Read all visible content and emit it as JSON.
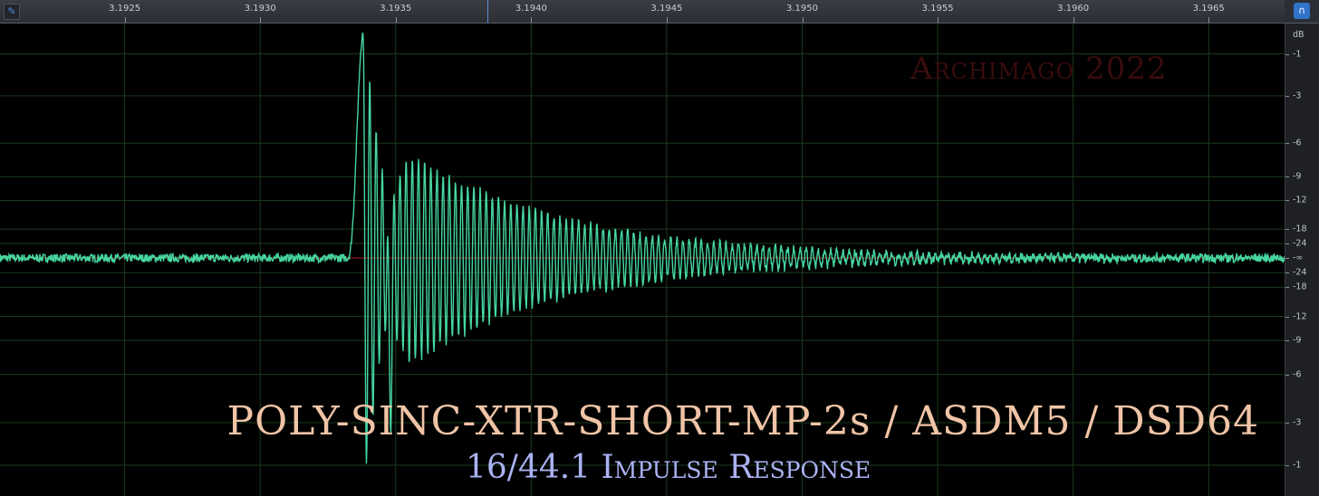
{
  "ruler": {
    "labels": [
      "3.1925",
      "3.1930",
      "3.1935",
      "3.1940",
      "3.1945",
      "3.1950",
      "3.1955",
      "3.1960",
      "3.1965"
    ],
    "values": [
      3.1925,
      3.193,
      3.1935,
      3.194,
      3.1945,
      3.195,
      3.1955,
      3.196,
      3.1965
    ],
    "range_seconds": [
      3.19204,
      3.19678
    ],
    "playhead_time": 3.19384
  },
  "db_scale": {
    "unit": "dB",
    "upper_labels": [
      "-1",
      "-3",
      "-6",
      "-9",
      "-12",
      "-18",
      "-24"
    ],
    "center_label": "-∞",
    "lower_labels": [
      "-24",
      "-18",
      "-12",
      "-9",
      "-6",
      "-3",
      "-1"
    ]
  },
  "colors": {
    "waveform": "#46d6a0",
    "center_line": "#b0202a",
    "grid": "#1b3a1e",
    "title": "#f0c4a6",
    "subtitle": "#aab2f2",
    "watermark": "#3a0c0c"
  },
  "icons": {
    "pin": "pin-icon",
    "monitor": "headphones-icon"
  },
  "watermark": "Archimago 2022",
  "caption": {
    "title": "POLY-SINC-XTR-SHORT-MP-2s / ASDM5 / DSD64",
    "subtitle": "16/44.1 Impulse Response"
  },
  "waveform": {
    "description_of_signal": "minimum-phase impulse",
    "onset_time": 3.19332,
    "peak_time": 3.19338,
    "peak_amplitude": 0.98,
    "first_trough_time": 3.19348,
    "first_trough_amplitude": -0.78,
    "ring_period_seconds": 2.27e-05,
    "decay_amplitude": 0.62,
    "noise_amplitude": 0.018
  }
}
